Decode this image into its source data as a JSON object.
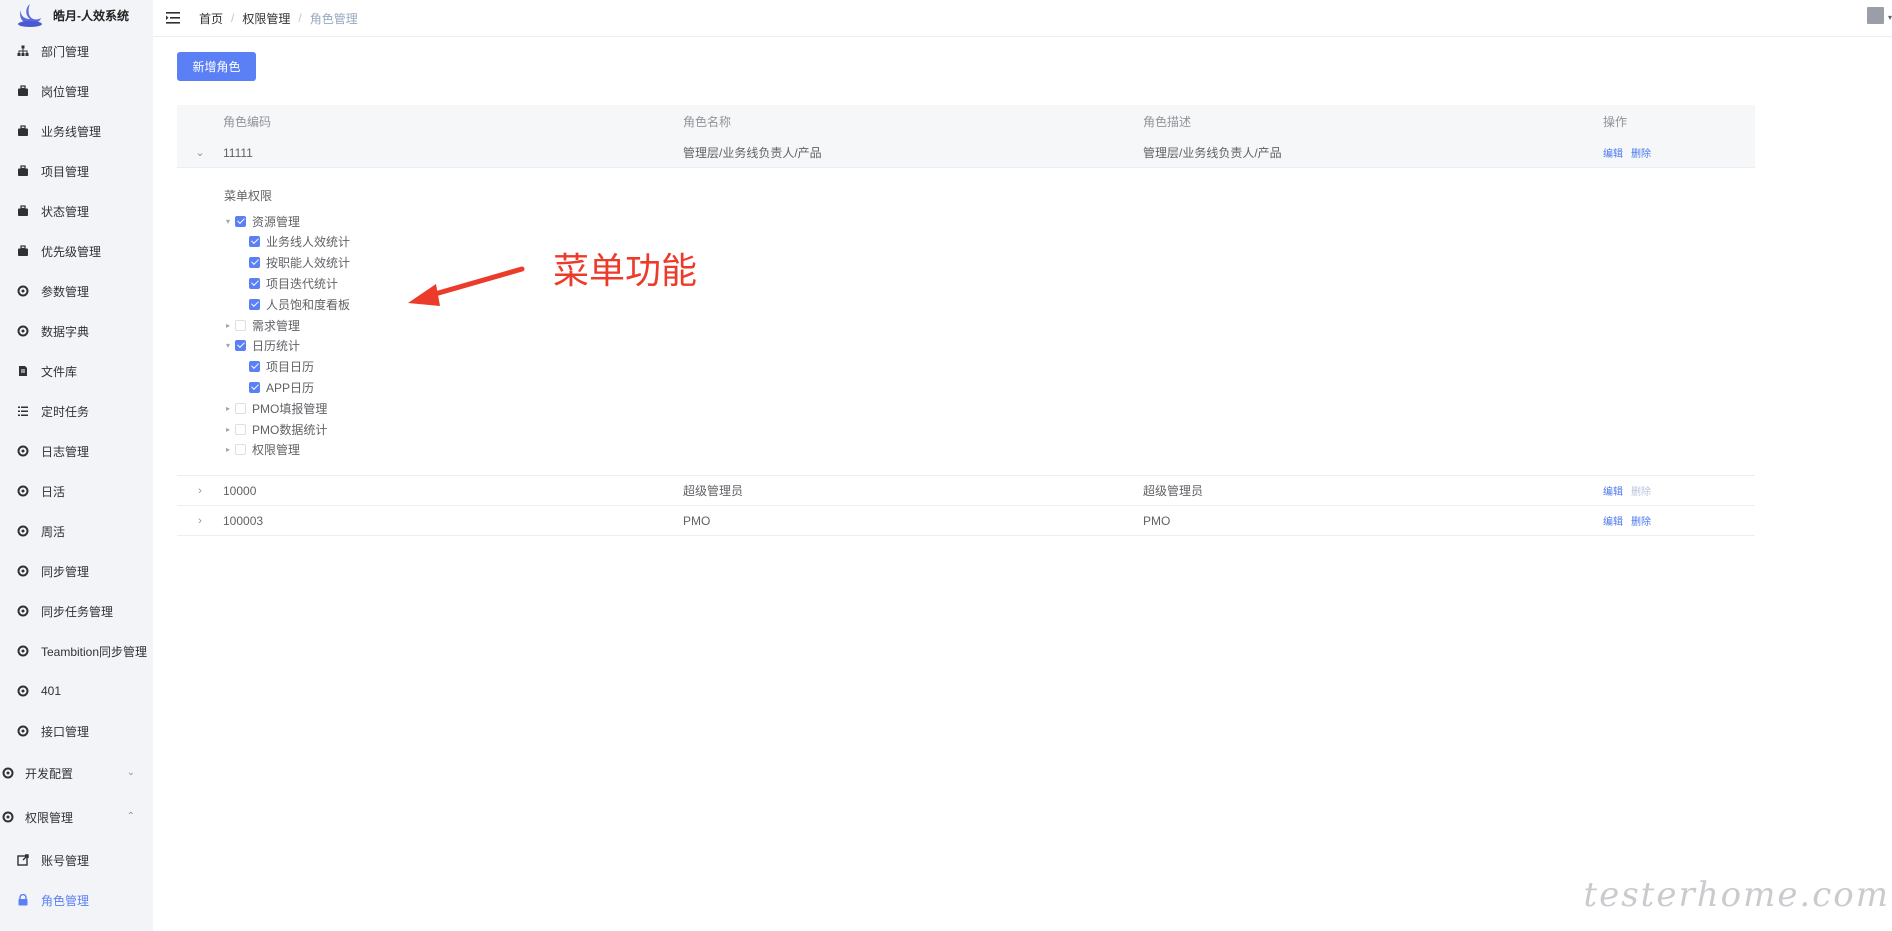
{
  "app": {
    "title": "皓月-人效系统"
  },
  "sidebar": {
    "items": [
      {
        "label": "部门管理",
        "icon": "org-tree-icon"
      },
      {
        "label": "岗位管理",
        "icon": "briefcase-icon"
      },
      {
        "label": "业务线管理",
        "icon": "briefcase-icon"
      },
      {
        "label": "项目管理",
        "icon": "briefcase-icon"
      },
      {
        "label": "状态管理",
        "icon": "briefcase-icon"
      },
      {
        "label": "优先级管理",
        "icon": "briefcase-icon"
      },
      {
        "label": "参数管理",
        "icon": "component-icon"
      },
      {
        "label": "数据字典",
        "icon": "component-icon"
      },
      {
        "label": "文件库",
        "icon": "document-icon"
      },
      {
        "label": "定时任务",
        "icon": "list-icon"
      },
      {
        "label": "日志管理",
        "icon": "component-icon"
      },
      {
        "label": "日活",
        "icon": "component-icon"
      },
      {
        "label": "周活",
        "icon": "component-icon"
      },
      {
        "label": "同步管理",
        "icon": "component-icon"
      },
      {
        "label": "同步任务管理",
        "icon": "component-icon"
      },
      {
        "label": "Teambition同步管理",
        "icon": "component-icon"
      },
      {
        "label": "401",
        "icon": "component-icon"
      },
      {
        "label": "接口管理",
        "icon": "component-icon"
      }
    ],
    "groups": [
      {
        "label": "开发配置",
        "expanded": false
      },
      {
        "label": "权限管理",
        "expanded": true
      }
    ],
    "sub_items": [
      {
        "label": "账号管理",
        "icon": "external-link-icon",
        "active": false
      },
      {
        "label": "角色管理",
        "icon": "lock-icon",
        "active": true
      }
    ]
  },
  "breadcrumb": [
    "首页",
    "权限管理",
    "角色管理"
  ],
  "toolbar": {
    "add_label": "新增角色"
  },
  "table": {
    "headers": {
      "code": "角色编码",
      "name": "角色名称",
      "desc": "角色描述",
      "op": "操作"
    },
    "edit_label": "编辑",
    "delete_label": "删除",
    "rows": [
      {
        "code": "11111",
        "name": "管理层/业务线负责人/产品",
        "desc": "管理层/业务线负责人/产品",
        "expanded": true,
        "delete_enabled": true
      },
      {
        "code": "10000",
        "name": "超级管理员",
        "desc": "超级管理员",
        "expanded": false,
        "delete_enabled": false
      },
      {
        "code": "100003",
        "name": "PMO",
        "desc": "PMO",
        "expanded": false,
        "delete_enabled": true
      }
    ]
  },
  "permissions": {
    "title": "菜单权限",
    "nodes": [
      {
        "label": "资源管理",
        "level": 0,
        "checked": true,
        "arrow": "down"
      },
      {
        "label": "业务线人效统计",
        "level": 1,
        "checked": true,
        "arrow": ""
      },
      {
        "label": "按职能人效统计",
        "level": 1,
        "checked": true,
        "arrow": ""
      },
      {
        "label": "项目迭代统计",
        "level": 1,
        "checked": true,
        "arrow": ""
      },
      {
        "label": "人员饱和度看板",
        "level": 1,
        "checked": true,
        "arrow": ""
      },
      {
        "label": "需求管理",
        "level": 0,
        "checked": false,
        "arrow": "right"
      },
      {
        "label": "日历统计",
        "level": 0,
        "checked": true,
        "arrow": "down"
      },
      {
        "label": "项目日历",
        "level": 1,
        "checked": true,
        "arrow": ""
      },
      {
        "label": "APP日历",
        "level": 1,
        "checked": true,
        "arrow": ""
      },
      {
        "label": "PMO填报管理",
        "level": 0,
        "checked": false,
        "arrow": "right"
      },
      {
        "label": "PMO数据统计",
        "level": 0,
        "checked": false,
        "arrow": "right"
      },
      {
        "label": "权限管理",
        "level": 0,
        "checked": false,
        "arrow": "right"
      }
    ]
  },
  "annotation": {
    "text": "菜单功能"
  },
  "watermark": {
    "text": "testerhome.com"
  },
  "colors": {
    "accent": "#5b7ff5",
    "annotation": "#ec3b2a",
    "sidebar_bg": "#f3f4f7"
  }
}
